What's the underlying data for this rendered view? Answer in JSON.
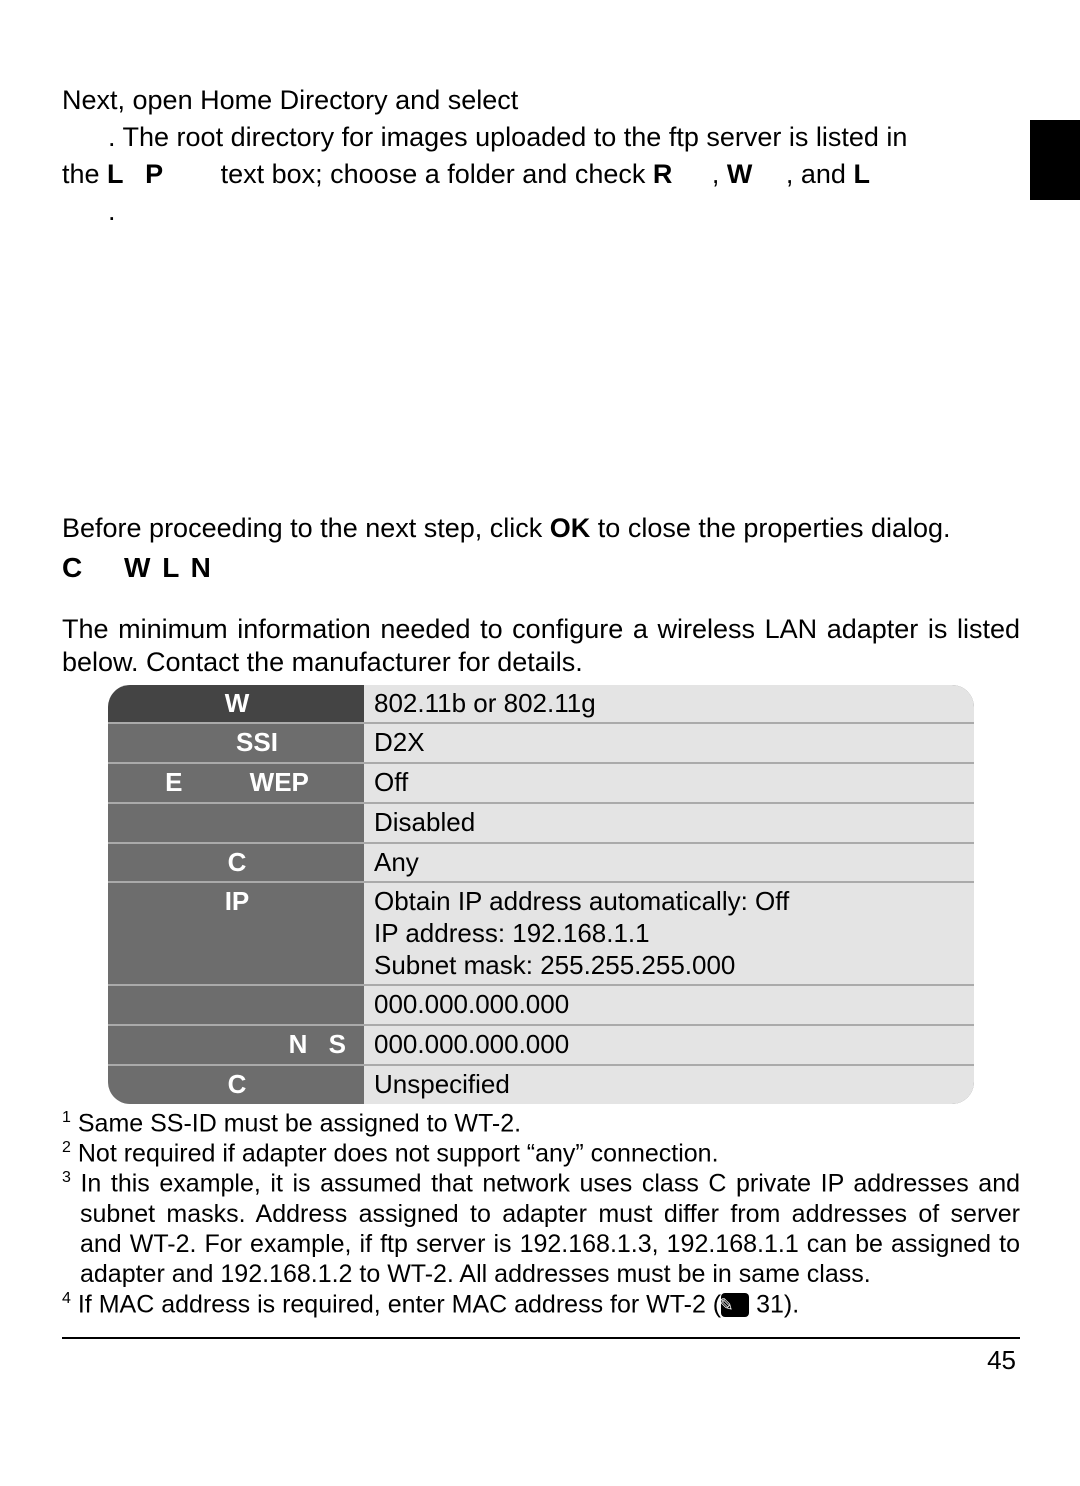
{
  "intro": {
    "line1a": "Next, open ",
    "line1b": "Home Directory",
    "line1c": " and select",
    "line2": ". The root directory for images uploaded to the ftp server is listed in",
    "line3a": "the ",
    "line3b": "L",
    "line3c": "P",
    "line3d": " text box; choose a folder and check ",
    "line3e": "R",
    "line3f": ", ",
    "line3g": "W",
    "line3h": ", and ",
    "line3i": "L",
    "line4": "."
  },
  "proceed": {
    "a": "Before proceeding to the next step, click ",
    "b": "OK",
    "c": " to close the properties dialog."
  },
  "section": {
    "head_a": "C",
    "head_b": "W",
    "head_c": "L",
    "head_d": "N",
    "desc": "The minimum information needed to conﬁgure a wireless LAN adapter is listed below.  Contact the manufacturer for details."
  },
  "table": {
    "r1k": "W",
    "r1v": "802.11b or 802.11g",
    "r2k": "SSI",
    "r2v": "D2X",
    "r3k": "E",
    "r3k2": "WEP",
    "r3v": "Off",
    "r4k": " ",
    "r4v": "Disabled",
    "r5k": "C",
    "r5v": "Any",
    "r6k": "IP",
    "r6v1": "Obtain IP address automatically: Off",
    "r6v2": "IP address: 192.168.1.1",
    "r6v3": "Subnet mask: 255.255.255.000",
    "r7k": " ",
    "r7v": "000.000.000.000",
    "r8k": "N",
    "r8k2": "S",
    "r8v": "000.000.000.000",
    "r9k": "C",
    "r9v": "Unspeciﬁed"
  },
  "foot": {
    "n1": "Same SS-ID must be assigned to WT-2.",
    "n2": "Not required if adapter does not support “any” connection.",
    "n3": "In this example, it is assumed that network uses class C private IP addresses and subnet masks.  Address assigned to adapter must differ from addresses of server and WT-2.  For example, if ftp server is 192.168.1.3, 192.168.1.1 can be assigned to adapter and 192.168.1.2 to WT-2.  All addresses must be in same class.",
    "n4a": "If MAC address is required, enter MAC address for WT-2 (",
    "n4b": " 31)."
  },
  "pagenum": "45"
}
